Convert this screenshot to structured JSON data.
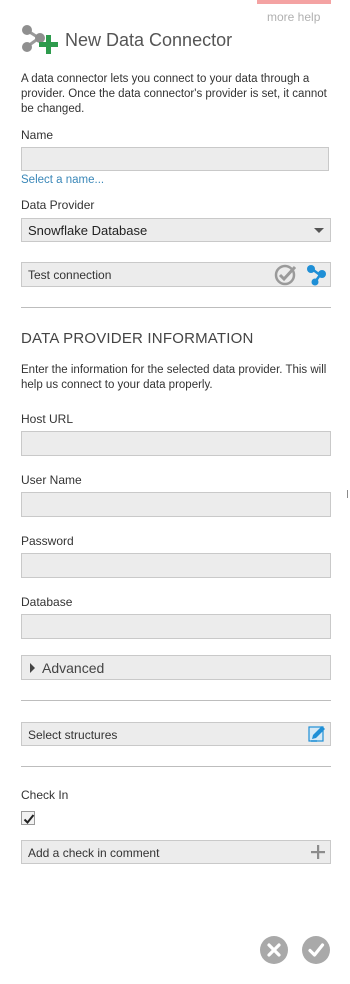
{
  "help": {
    "label": "more help"
  },
  "header": {
    "icon": "connector-add-icon",
    "title": "New Data Connector"
  },
  "intro": {
    "text": "A data connector lets you connect to your data through a provider. Once the data connector's provider is set, it cannot be changed."
  },
  "name_field": {
    "label": "Name",
    "value": "",
    "link_label": "Select a name..."
  },
  "provider": {
    "label": "Data Provider",
    "selected": "Snowflake Database"
  },
  "test_connection": {
    "label": "Test connection",
    "status_icon": "check-circle-icon",
    "action_icon": "connection-nodes-icon"
  },
  "provider_info": {
    "title": "DATA PROVIDER INFORMATION",
    "description": "Enter the information for the selected data provider. This will help us connect to your data properly.",
    "fields": [
      {
        "label": "Host URL",
        "value": ""
      },
      {
        "label": "User Name",
        "value": ""
      },
      {
        "label": "Password",
        "value": ""
      },
      {
        "label": "Database",
        "value": ""
      }
    ]
  },
  "advanced": {
    "label": "Advanced"
  },
  "structures": {
    "label": "Select structures",
    "icon": "edit-icon"
  },
  "check_in": {
    "label": "Check In",
    "checked": true,
    "comment_label": "Add a check in comment",
    "comment_icon": "plus-icon"
  },
  "footer": {
    "cancel_icon": "cancel-icon",
    "ok_icon": "ok-icon"
  },
  "colors": {
    "accent_link": "#3a87b8",
    "connector_blue": "#1f8fd6",
    "connector_green": "#2e9b4d",
    "field_bg": "#ececec",
    "button_gray": "#a9a9a9",
    "top_accent": "#f4a3a3"
  }
}
